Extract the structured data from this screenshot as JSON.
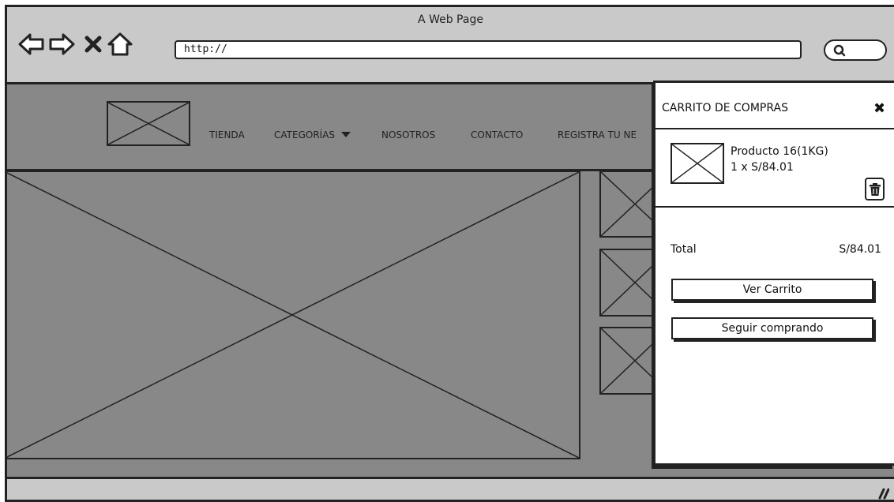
{
  "browser": {
    "title": "A Web Page",
    "url": "http://",
    "nav_icons": [
      "back-arrow-icon",
      "forward-arrow-icon",
      "close-x-icon",
      "home-icon"
    ],
    "search_icon": "search-icon"
  },
  "header": {
    "nav": [
      {
        "label": "TIENDA"
      },
      {
        "label": "CATEGORÍAS"
      },
      {
        "label": "NOSOTROS"
      },
      {
        "label": "CONTACTO"
      },
      {
        "label": "REGISTRA TU NE"
      }
    ]
  },
  "cart": {
    "title": "CARRITO DE COMPRAS",
    "close_icon": "close-icon",
    "item": {
      "name": "Producto 16(1KG)",
      "qty_price": "1 x S/84.01",
      "delete_icon": "trash-icon"
    },
    "total_label": "Total",
    "total_value": "S/84.01",
    "view_cart_label": "Ver Carrito",
    "continue_label": "Seguir comprando"
  },
  "colors": {
    "chrome": "#c9c9c9",
    "page_bg": "#888888",
    "outline": "#222222",
    "panel": "#ffffff"
  }
}
